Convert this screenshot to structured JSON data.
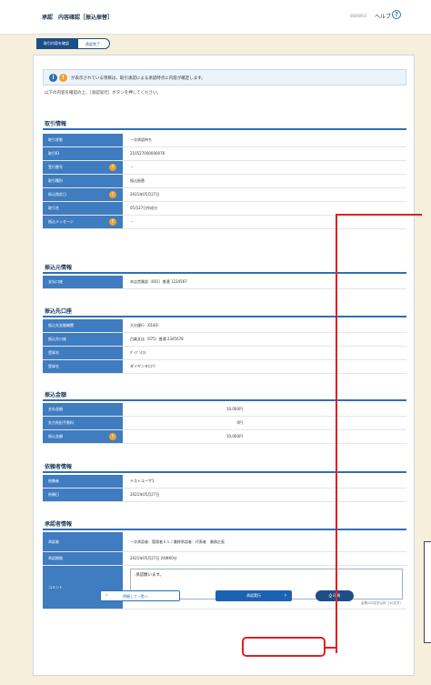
{
  "header": {
    "step_word": "承認",
    "title": "内容確認［振込振替］",
    "screen_id": "BSKN003",
    "help_label": "ヘルプ",
    "help_icon": "?"
  },
  "steps": [
    "取引内容を確認",
    "承認完了"
  ],
  "notice": {
    "icon1": "i",
    "icon2": "!",
    "text": "が表示されている項目は、取引承認による承認時点に内容が確定します。"
  },
  "intro": "以下の内容を確認の上、［承認実行］ボタンを押してください。",
  "sections": {
    "trade": {
      "title": "取引情報",
      "rows": [
        {
          "label": "取引状態",
          "value": "一次承認待ち",
          "req": false
        },
        {
          "label": "取引ID",
          "value": "210527000000076",
          "req": false
        },
        {
          "label": "受付番号",
          "value": "－",
          "req": true
        },
        {
          "label": "取引種別",
          "value": "振込振替",
          "req": false
        },
        {
          "label": "振込指定日",
          "value": "2021年05月27日",
          "req": true
        },
        {
          "label": "取引名",
          "value": "05月27日作成分",
          "req": false
        },
        {
          "label": "振込メッセージ",
          "value": "－",
          "req": true
        }
      ]
    },
    "source": {
      "title": "振込元情報",
      "rows": [
        {
          "label": "支払口座",
          "value": "本店営業部（001）普通 1234567",
          "req": false
        }
      ]
    },
    "dest": {
      "title": "振込先口座",
      "rows": [
        {
          "label": "振込先金融機関",
          "value": "大分銀行（0183）",
          "req": false
        },
        {
          "label": "振込先口座",
          "value": "白楽支店（075）普通 2345678",
          "req": false
        },
        {
          "label": "登録名",
          "value": "ﾀﾞｲﾌﾞﾝ(ｶ)",
          "req": false
        },
        {
          "label": "登録名",
          "value": "ダイギンタロウ",
          "req": false
        }
      ]
    },
    "amount": {
      "title": "振込金額",
      "rows": [
        {
          "label": "支払金額",
          "value": "10,000円",
          "req": false
        },
        {
          "label": "先方負担手数料",
          "value": "0円",
          "req": false
        },
        {
          "label": "振込金額",
          "value": "10,000円",
          "req": true
        }
      ]
    },
    "applicant": {
      "title": "依頼者情報",
      "rows": [
        {
          "label": "依頼者",
          "value": "テストユーザ1",
          "req": false
        },
        {
          "label": "依頼日",
          "value": "2021年05月27日",
          "req": false
        }
      ]
    },
    "approver": {
      "title": "承認者情報",
      "rows": [
        {
          "label": "承認者",
          "value": "一次承認者：管理者０１ / 最終承認者：代表者　業務企画",
          "req": false
        },
        {
          "label": "承認期限",
          "value": "2021年05月27日 24時00分",
          "req": false
        }
      ],
      "comment_label": "コメント",
      "comment_value": "承認願います。",
      "comment_count": "全角120文字以内［10文字］"
    }
  },
  "buttons": {
    "back_arrow": "‹",
    "back": "明細して一覧へ",
    "exec": "承認実行",
    "exec_arrow": "›",
    "print": "印刷",
    "print_icon": "⎙"
  }
}
